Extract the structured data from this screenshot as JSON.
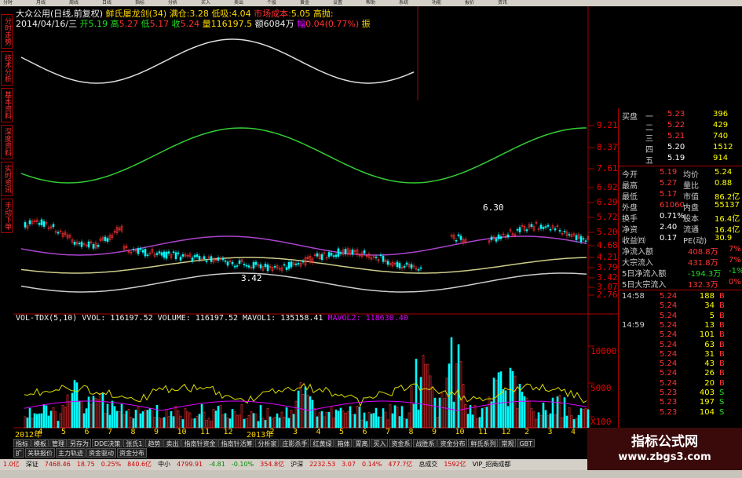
{
  "toolbar": {
    "items": [
      "分时",
      "月线",
      "周线",
      "日线",
      "指标",
      "分析",
      "买入",
      "卖出",
      "个股",
      "黄金",
      "设置",
      "帮助",
      "系统",
      "功能",
      "报价",
      "资讯"
    ]
  },
  "side_tabs": [
    "分时走势",
    "技术分析",
    "基本资料",
    "深度资料",
    "实时资讯",
    "手动下单"
  ],
  "header": {
    "line1": {
      "name": "大众公用",
      "period": "(日线,前复权)",
      "indicator": "鲜氏屡龙剑(34)",
      "p1": "满仓:",
      "v1": "3.28",
      "p2": "低吸:",
      "v2": "4.04",
      "p3": "市场成本:",
      "v3": "5.05",
      "p4": "高抛:"
    },
    "line2": {
      "date": "2014/04/16/三",
      "open_l": "开",
      "open": "5.19",
      "high_l": "高",
      "high": "5.27",
      "low_l": "低",
      "low": "5.17",
      "close_l": "收",
      "close": "5.24",
      "vol_l": "量",
      "vol": "116197.5",
      "amt_l": "额",
      "amt": "6084万",
      "chg_l": "幅",
      "chg": "0.04(0.77%)",
      "amp_l": "振"
    }
  },
  "price_axis": [
    "9.21",
    "8.37",
    "7.61",
    "6.92",
    "6.29",
    "5.72",
    "5.20",
    "4.68",
    "4.21",
    "3.79",
    "3.42",
    "3.07",
    "2.76"
  ],
  "chart_labels": {
    "hi": "6.30",
    "lo": "3.42"
  },
  "vol_header": {
    "name": "VOL-TDX(5,10)",
    "vvol": "VVOL: 116197.52",
    "volume": "VOLUME: 116197.52",
    "mavol1": "MAVOL1: 135158.41",
    "mavol2": "MAVOL2: 118630.40"
  },
  "vol_axis": [
    "10000",
    "5000",
    "X100"
  ],
  "time_axis": [
    "2012年",
    "4",
    "5",
    "6",
    "7",
    "8",
    "9",
    "10",
    "11",
    "12",
    "2013年",
    "2",
    "3",
    "4",
    "5",
    "6",
    "7",
    "8",
    "9",
    "10",
    "11",
    "12",
    "2",
    "3",
    "4"
  ],
  "bid_ask": [
    {
      "l": "买盘",
      "n": "一",
      "p": "5.23",
      "v": "396"
    },
    {
      "l": "",
      "n": "二",
      "p": "5.22",
      "v": "429"
    },
    {
      "l": "",
      "n": "三",
      "p": "5.21",
      "v": "740"
    },
    {
      "l": "",
      "n": "四",
      "p": "5.20",
      "v": "1512"
    },
    {
      "l": "",
      "n": "五",
      "p": "5.19",
      "v": "914"
    }
  ],
  "quote": [
    {
      "a": "今开",
      "av": "5.19",
      "b": "均价",
      "bv": "5.24"
    },
    {
      "a": "最高",
      "av": "5.27",
      "b": "量比",
      "bv": "0.88"
    },
    {
      "a": "最低",
      "av": "5.17",
      "b": "市值",
      "bv": "86.2亿"
    },
    {
      "a": "外盘",
      "av": "61060",
      "b": "内盘",
      "bv": "55137"
    },
    {
      "a": "换手",
      "av": "0.71%",
      "b": "股本",
      "bv": "16.4亿"
    },
    {
      "a": "净资",
      "av": "2.40",
      "b": "流通",
      "bv": "16.4亿"
    },
    {
      "a": "收益㈣",
      "av": "0.17",
      "b": "PE(动)",
      "bv": "30.9"
    }
  ],
  "flows": [
    {
      "l": "净流入额",
      "v": "408.8万",
      "p": "7%"
    },
    {
      "l": "大宗流入",
      "v": "431.8万",
      "p": "7%"
    },
    {
      "l": "5日净流入额",
      "v": "-194.3万",
      "p": "-1%"
    },
    {
      "l": "5日大宗流入",
      "v": "132.3万",
      "p": "0%"
    }
  ],
  "ticks": [
    {
      "t": "14:58",
      "p": "5.24",
      "v": "188",
      "s": "B"
    },
    {
      "t": "",
      "p": "5.24",
      "v": "34",
      "s": "B"
    },
    {
      "t": "",
      "p": "5.24",
      "v": "5",
      "s": "B"
    },
    {
      "t": "14:59",
      "p": "5.24",
      "v": "13",
      "s": "B"
    },
    {
      "t": "",
      "p": "5.24",
      "v": "101",
      "s": "B"
    },
    {
      "t": "",
      "p": "5.24",
      "v": "63",
      "s": "B"
    },
    {
      "t": "",
      "p": "5.24",
      "v": "31",
      "s": "B"
    },
    {
      "t": "",
      "p": "5.24",
      "v": "43",
      "s": "B"
    },
    {
      "t": "",
      "p": "5.24",
      "v": "26",
      "s": "B"
    },
    {
      "t": "",
      "p": "5.24",
      "v": "20",
      "s": "B"
    },
    {
      "t": "",
      "p": "5.23",
      "v": "403",
      "s": "S"
    },
    {
      "t": "",
      "p": "5.23",
      "v": "197",
      "s": "S"
    },
    {
      "t": "",
      "p": "5.23",
      "v": "104",
      "s": "S"
    }
  ],
  "tabs": [
    "指标",
    "模板",
    "管理",
    "另存为",
    "DDE决策",
    "张氏1",
    "趋势",
    "卖出",
    "指南针资金",
    "指南针活筹",
    "分析家",
    "庄影杀手",
    "红黄绿",
    "箱体",
    "胃离",
    "买入",
    "资金系",
    "战胜系",
    "资金分布",
    "鲜氏系列",
    "常规",
    "GBT"
  ],
  "tabs2": [
    "扩",
    "关联报价",
    "主力轨迹",
    "资金驱动",
    "资金分布"
  ],
  "status": [
    "1.0亿",
    "深证",
    "7468.46",
    "18.75",
    "0.25%",
    "840.6亿",
    "中小",
    "4799.91",
    "-4.81",
    "-0.10%",
    "354.8亿",
    "沪深",
    "2232.53",
    "3.07",
    "0.14%",
    "477.7亿",
    "总成交",
    "1592亿",
    "VIP_招商成都"
  ],
  "watermark": {
    "t1": "指标公式网",
    "t2": "www.zbgs3.com"
  }
}
